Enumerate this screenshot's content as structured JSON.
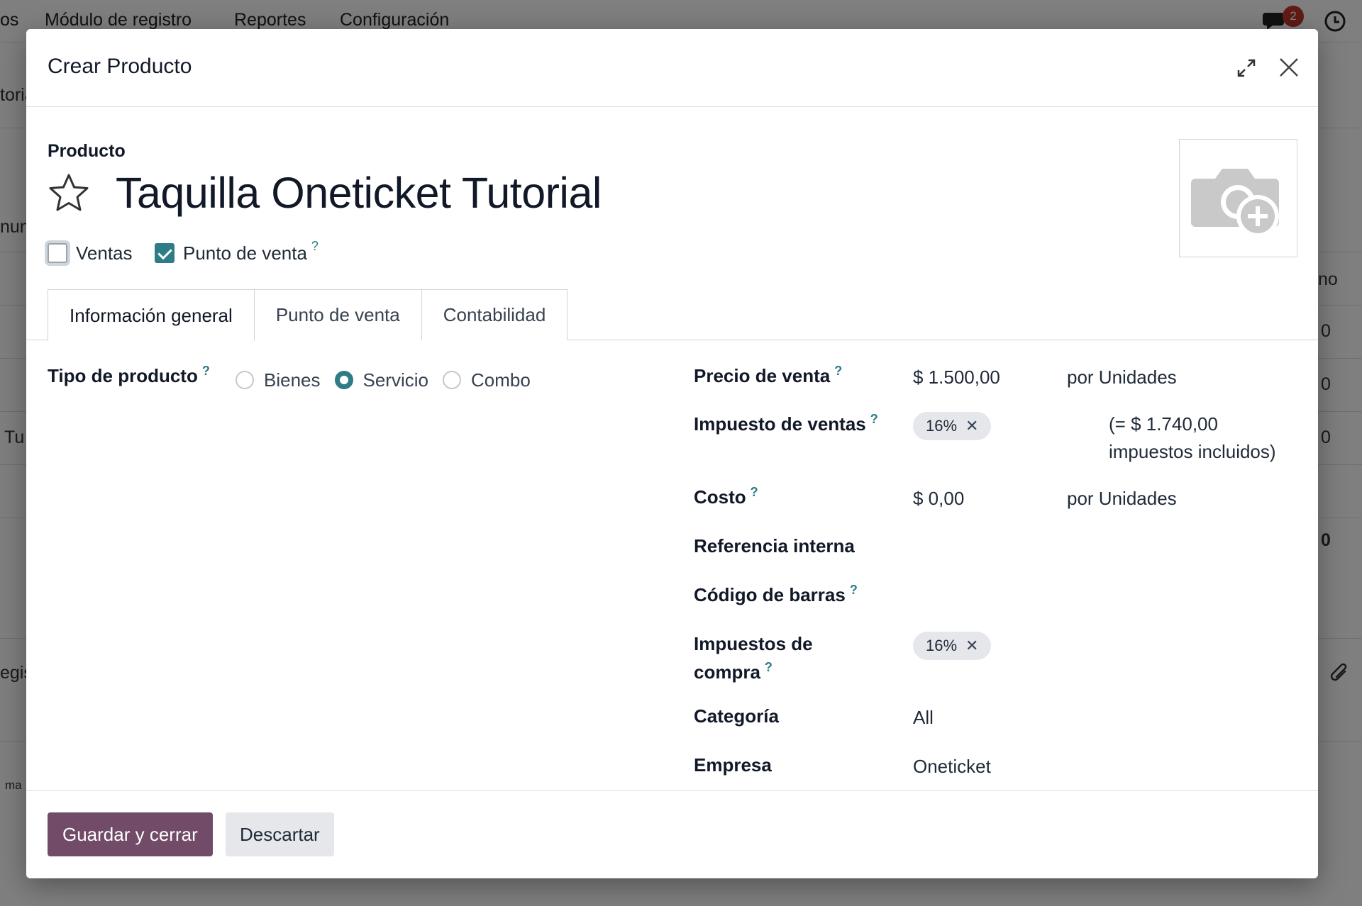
{
  "background": {
    "nav_items": [
      "os",
      "Módulo de registro",
      "Reportes",
      "Configuración"
    ],
    "notification_count": "2",
    "fragments": [
      "toria",
      "nuni",
      "Tu",
      "egis",
      "ma",
      "no",
      "0",
      "0",
      "0",
      "0"
    ]
  },
  "modal": {
    "title": "Crear Producto",
    "product_label": "Producto",
    "product_name": "Taquilla Oneticket Tutorial",
    "checkboxes": [
      {
        "label": "Ventas",
        "checked": false
      },
      {
        "label": "Punto de venta",
        "checked": true,
        "help": "?"
      }
    ],
    "tabs": [
      "Información general",
      "Punto de venta",
      "Contabilidad"
    ],
    "active_tab": "Información general",
    "product_type": {
      "label": "Tipo de producto",
      "help": "?",
      "options": [
        "Bienes",
        "Servicio",
        "Combo"
      ],
      "selected": "Servicio"
    },
    "fields": {
      "sale_price": {
        "label": "Precio de venta",
        "help": "?",
        "value": "$ 1.500,00",
        "unit": "por Unidades"
      },
      "sales_tax": {
        "label": "Impuesto de ventas",
        "help": "?",
        "tag": "16%",
        "note_line1": "(= $ 1.740,00",
        "note_line2": "impuestos incluidos)"
      },
      "cost": {
        "label": "Costo",
        "help": "?",
        "value": "$ 0,00",
        "unit": "por Unidades"
      },
      "internal_ref": {
        "label": "Referencia interna",
        "value": ""
      },
      "barcode": {
        "label": "Código de barras",
        "help": "?",
        "value": ""
      },
      "purchase_tax": {
        "label_line1": "Impuestos de",
        "label_line2": "compra",
        "help": "?",
        "tag": "16%"
      },
      "category": {
        "label": "Categoría",
        "value": "All"
      },
      "company": {
        "label": "Empresa",
        "value": "Oneticket"
      }
    },
    "footer": {
      "save_label": "Guardar y cerrar",
      "discard_label": "Descartar"
    }
  },
  "colors": {
    "primary": "#714b67",
    "accent": "#2f7c86",
    "tag_bg": "#e5e7eb"
  }
}
